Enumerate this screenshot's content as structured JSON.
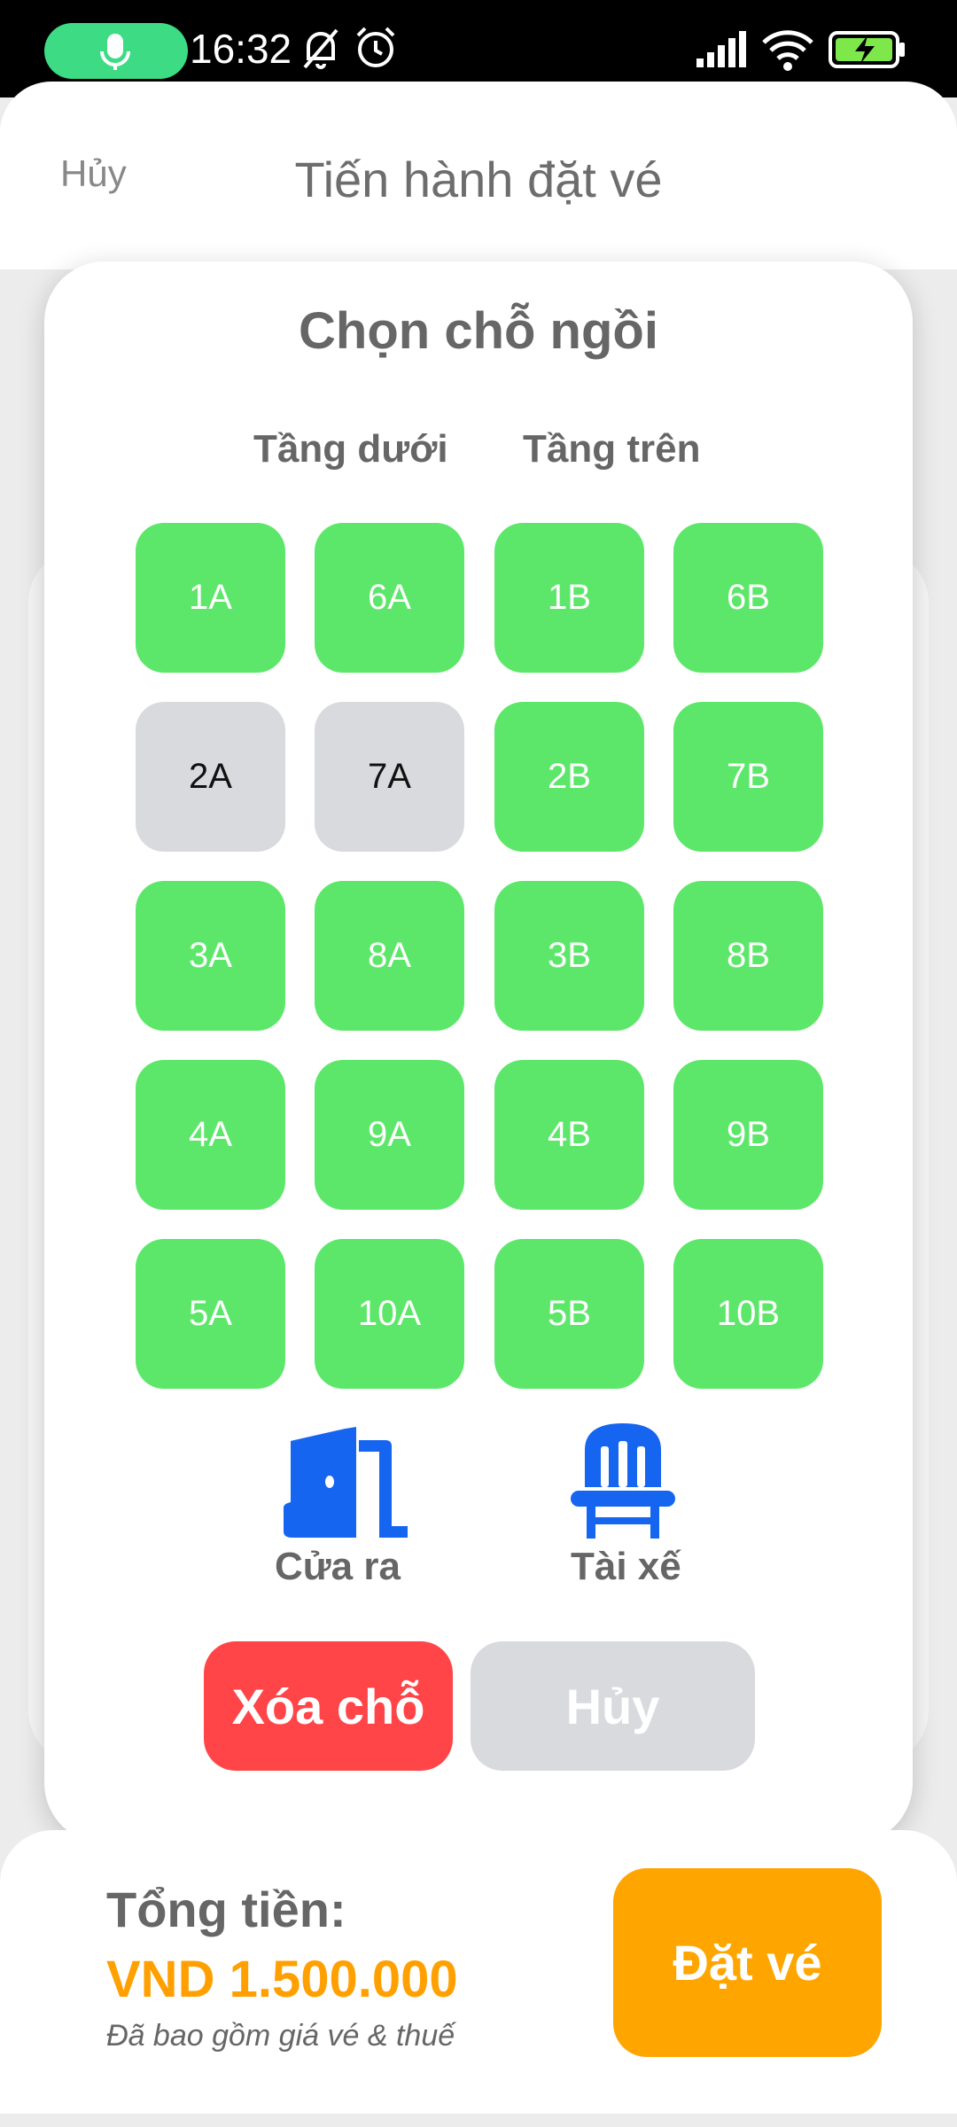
{
  "status_bar": {
    "time": "16:32",
    "icons": [
      "mic-icon",
      "bell-off-icon",
      "alarm-icon",
      "signal-icon",
      "wifi-icon",
      "battery-charging-icon"
    ]
  },
  "header": {
    "cancel_label": "Hủy",
    "title": "Tiến hành đặt vé"
  },
  "modal": {
    "title": "Chọn chỗ ngồi",
    "deck_lower_label": "Tầng dưới",
    "deck_upper_label": "Tầng trên",
    "seats": [
      {
        "id": "1A",
        "status": "available"
      },
      {
        "id": "6A",
        "status": "available"
      },
      {
        "id": "1B",
        "status": "available"
      },
      {
        "id": "6B",
        "status": "available"
      },
      {
        "id": "2A",
        "status": "taken"
      },
      {
        "id": "7A",
        "status": "taken"
      },
      {
        "id": "2B",
        "status": "available"
      },
      {
        "id": "7B",
        "status": "available"
      },
      {
        "id": "3A",
        "status": "available"
      },
      {
        "id": "8A",
        "status": "available"
      },
      {
        "id": "3B",
        "status": "available"
      },
      {
        "id": "8B",
        "status": "available"
      },
      {
        "id": "4A",
        "status": "available"
      },
      {
        "id": "9A",
        "status": "available"
      },
      {
        "id": "4B",
        "status": "available"
      },
      {
        "id": "9B",
        "status": "available"
      },
      {
        "id": "5A",
        "status": "available"
      },
      {
        "id": "10A",
        "status": "available"
      },
      {
        "id": "5B",
        "status": "available"
      },
      {
        "id": "10B",
        "status": "available"
      }
    ],
    "legend": {
      "exit_label": "Cửa ra",
      "driver_label": "Tài xế"
    },
    "clear_button": "Xóa chỗ",
    "cancel_button": "Hủy"
  },
  "footer": {
    "total_label": "Tổng tiền:",
    "total_value": "VND 1.500.000",
    "note": "Đã bao gồm giá vé & thuế",
    "book_button": "Đặt vé"
  },
  "colors": {
    "available": "#5de76a",
    "taken": "#d9dade",
    "accent": "#ffa500",
    "danger": "#ff4548",
    "icon_blue": "#1565f0"
  }
}
